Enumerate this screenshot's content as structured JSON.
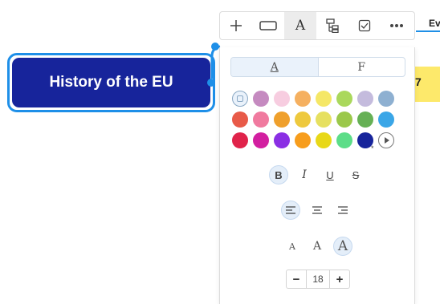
{
  "canvas": {
    "topic_text": "History of the EU",
    "partial_label": "Ev",
    "partial_node_text": "7"
  },
  "toolbar": {
    "items": [
      {
        "name": "add-icon"
      },
      {
        "name": "shape-icon"
      },
      {
        "name": "text-style-icon",
        "label": "A",
        "active": true
      },
      {
        "name": "structure-icon"
      },
      {
        "name": "task-checkbox-icon"
      },
      {
        "name": "more-icon"
      }
    ]
  },
  "panel": {
    "tabs": {
      "fill_tab": "A",
      "font_tab": "F"
    },
    "colors": [
      "#c58ac0",
      "#f7cde0",
      "#f5b060",
      "#f5e766",
      "#aad85c",
      "#c4bbdd",
      "#8eb0d1",
      "#e85a48",
      "#f07a9f",
      "#efa02c",
      "#eec93e",
      "#e6e060",
      "#9bc84a",
      "#66b055",
      "#3aa6e7",
      "#e0234a",
      "#d21fa0",
      "#8a2fe4",
      "#f79d1c",
      "#e8d818",
      "#5cdd88",
      "#17249b"
    ],
    "selected_color_marker": "*",
    "format": {
      "bold": "B",
      "italic": "I",
      "underline": "U",
      "strike": "S"
    },
    "align": [
      "left",
      "center",
      "right"
    ],
    "size_presets": {
      "small": "A",
      "medium": "A",
      "large": "A"
    },
    "font_size": {
      "minus": "−",
      "value": "18",
      "plus": "+"
    }
  }
}
